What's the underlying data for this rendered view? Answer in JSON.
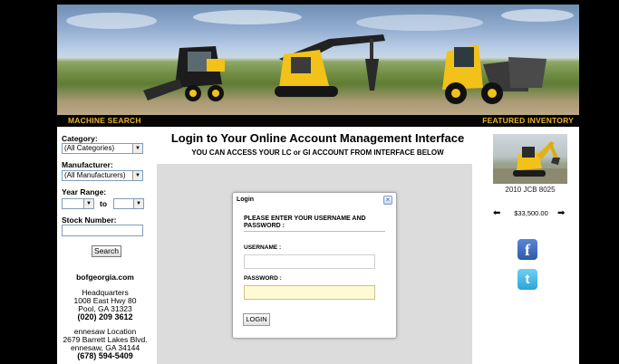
{
  "nav": {
    "left": "MACHINE SEARCH",
    "right": "FEATURED INVENTORY"
  },
  "sidebar": {
    "category_label": "Category:",
    "category_value": "(All Categories)",
    "manufacturer_label": "Manufacturer:",
    "manufacturer_value": "(All Manufacturers)",
    "year_label": "Year Range:",
    "year_to": "to",
    "stock_label": "Stock Number:",
    "search_button": "Search",
    "site": "bofgeorgia.com",
    "hq_title": "Headquarters",
    "hq_addr1": "1008 East Hwy 80",
    "hq_addr2": "Pool, GA 31323",
    "hq_phone": "(020) 209 3612",
    "loc_title": "ennesaw Location",
    "loc_addr1": "2679 Barrett Lakes Blvd.",
    "loc_addr2": "ennesaw, GA 34144",
    "loc_phone": "(678) 594-5409"
  },
  "main": {
    "title": "Login to Your Online Account Management Interface",
    "subtitle": "YOU CAN ACCESS YOUR LC or GI ACCOUNT FROM INTERFACE BELOW"
  },
  "dialog": {
    "title": "Login",
    "close": "×",
    "message": "PLEASE ENTER YOUR USERNAME AND PASSWORD :",
    "username_label": "USERNAME :",
    "password_label": "PASSWORD :",
    "username_value": "",
    "password_value": "",
    "login_button": "LOGIN"
  },
  "featured": {
    "caption": "2010 JCB 8025",
    "price": "$33,500.00",
    "prev": "⬅",
    "next": "➡"
  },
  "social": {
    "facebook": "f",
    "twitter": "t"
  },
  "colors": {
    "nav_accent": "#e8b330",
    "machine_yellow": "#f2c21a"
  }
}
